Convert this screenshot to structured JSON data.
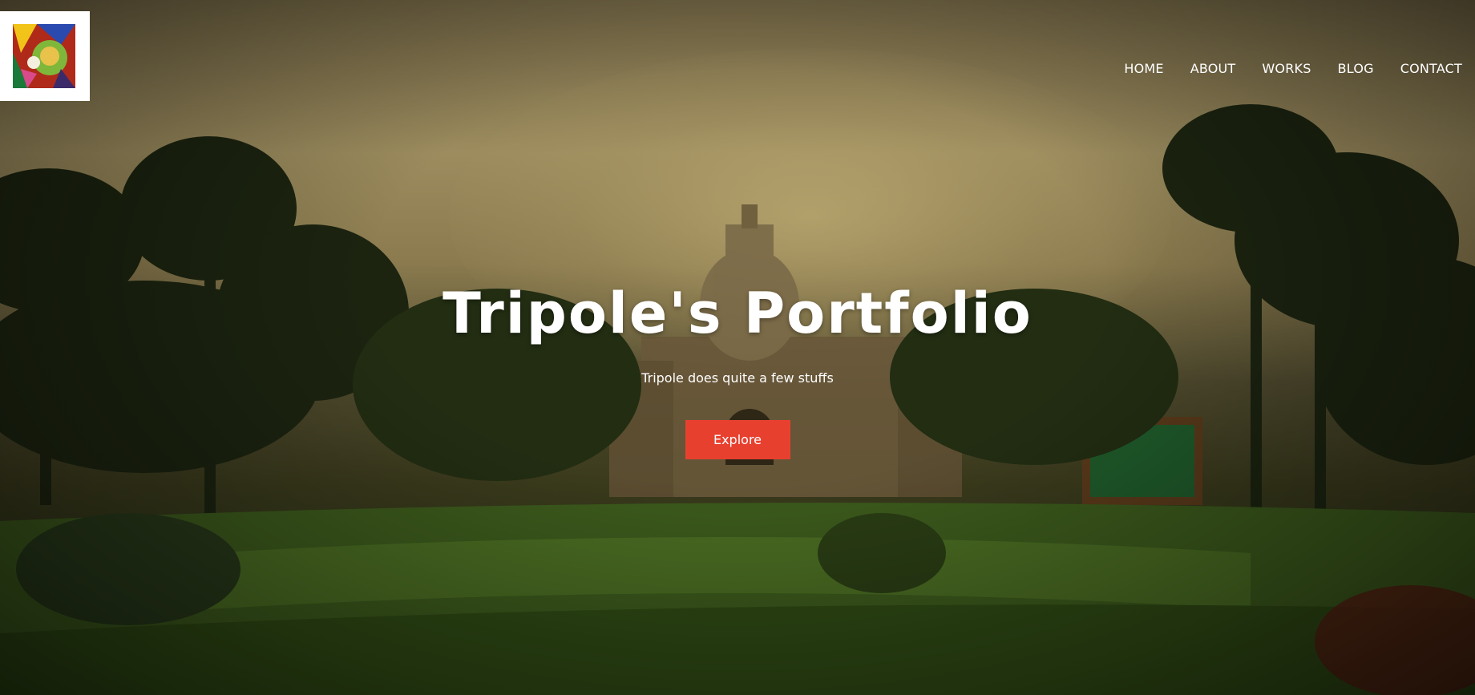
{
  "header": {
    "logo_icon": "kathakali-art-logo-icon"
  },
  "nav": {
    "items": [
      {
        "label": "HOME"
      },
      {
        "label": "ABOUT"
      },
      {
        "label": "WORKS"
      },
      {
        "label": "BLOG"
      },
      {
        "label": "CONTACT"
      }
    ]
  },
  "hero": {
    "title": "Tripole's Portfolio",
    "subtitle": "Tripole does quite a few stuffs",
    "button_label": "Explore",
    "button_color": "#e8402f"
  },
  "colors": {
    "text": "#ffffff",
    "accent": "#e8402f"
  }
}
